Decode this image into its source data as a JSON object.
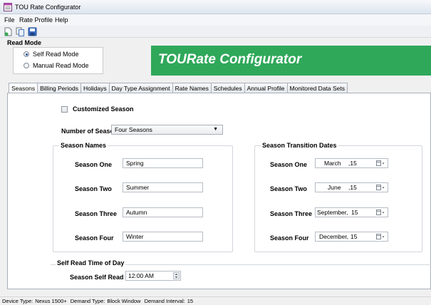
{
  "window": {
    "title": "TOU Rate Configurator"
  },
  "menu": {
    "items": [
      "File",
      "Rate Profile",
      "Help"
    ]
  },
  "toolbar": {
    "icons": [
      "new-icon",
      "copy-icon",
      "save-icon"
    ]
  },
  "read_mode": {
    "title": "Read Mode",
    "options": [
      {
        "label": "Self Read Mode",
        "checked": true
      },
      {
        "label": "Manual Read Mode",
        "checked": false
      }
    ]
  },
  "banner": {
    "text": "TOURate Configurator",
    "color": "#2fa85a"
  },
  "tabs": [
    {
      "label": "Seasons",
      "active": true
    },
    {
      "label": "Billing Periods"
    },
    {
      "label": "Holidays"
    },
    {
      "label": "Day Type Assignment"
    },
    {
      "label": "Rate Names"
    },
    {
      "label": "Schedules"
    },
    {
      "label": "Annual Profile"
    },
    {
      "label": "Monitored Data Sets"
    }
  ],
  "seasons": {
    "customized_label": "Customized Season",
    "customized_checked": false,
    "number_label": "Number of Seasons",
    "number_value": "Four Seasons",
    "names_title": "Season Names",
    "names": [
      {
        "label": "Season One",
        "value": "Spring"
      },
      {
        "label": "Season Two",
        "value": "Summer"
      },
      {
        "label": "Season Three",
        "value": "Autumn"
      },
      {
        "label": "Season Four",
        "value": "Winter"
      }
    ],
    "transition_title": "Season Transition Dates",
    "transitions": [
      {
        "label": "Season One",
        "month": "March",
        "day": ",15"
      },
      {
        "label": "Season Two",
        "month": "June",
        "day": ",15"
      },
      {
        "label": "Season Three",
        "month": "September,",
        "day": "15"
      },
      {
        "label": "Season Four",
        "month": "December,",
        "day": "15"
      }
    ]
  },
  "self_read": {
    "title": "Self Read Time of Day",
    "label": "Season Self Read",
    "value": "12:00 AM"
  },
  "status": {
    "device_type_label": "Device Type:",
    "device_type": "Nexus 1500+",
    "demand_type_label": "Demand Type:",
    "demand_type": "Block Window",
    "demand_interval_label": "Demand Interval:",
    "demand_interval": "15"
  }
}
